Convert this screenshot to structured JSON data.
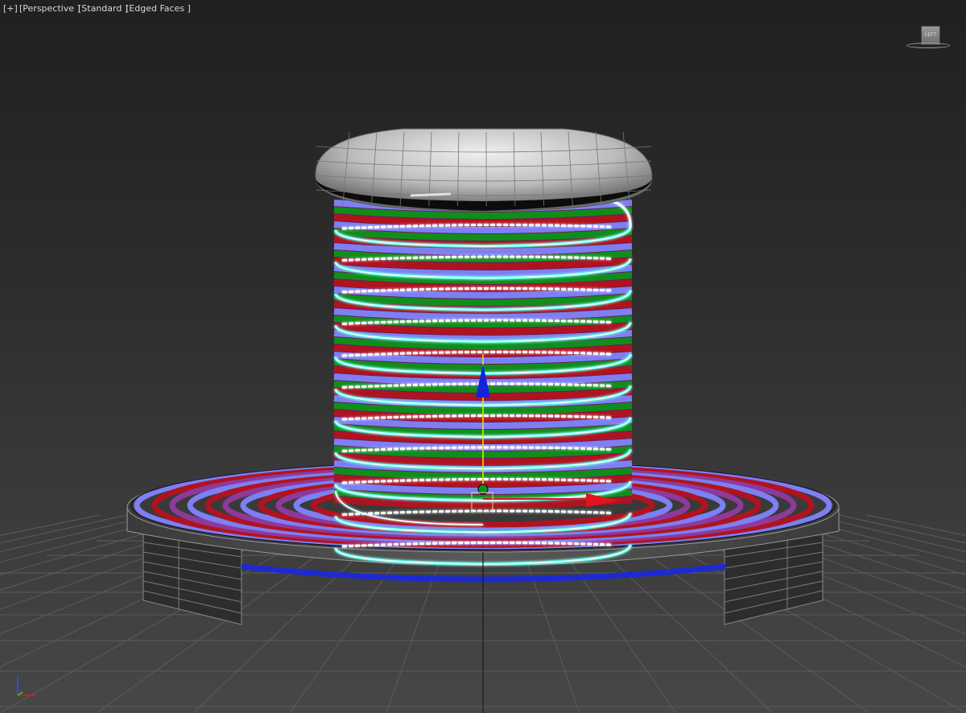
{
  "viewport": {
    "menus": [
      {
        "label": "[+]"
      },
      {
        "label": "[Perspective ]"
      },
      {
        "label": "[Standard ]"
      },
      {
        "label": "[Edged Faces ]"
      }
    ],
    "viewcube_face_label": "LEFT"
  },
  "colors": {
    "background_top": "#202020",
    "background_bottom": "#474747",
    "grid": "#5c5c5c",
    "coil_red": "#b01320",
    "coil_green": "#0f8e1c",
    "coil_blue": "#7d7ff2",
    "coil_purple": "#8d3a9a",
    "selected_spline": "#e8ffff",
    "selection_glow": "#3cf0d8",
    "gizmo_z": "#1422d8",
    "gizmo_x": "#e0141e",
    "gizmo_y": "#e8e818",
    "cap_gray": "#bdbdbd",
    "base_gray": "#505050"
  },
  "icons": [
    "viewcube-icon",
    "transform-gizmo-icon",
    "axis-tripod-icon"
  ]
}
